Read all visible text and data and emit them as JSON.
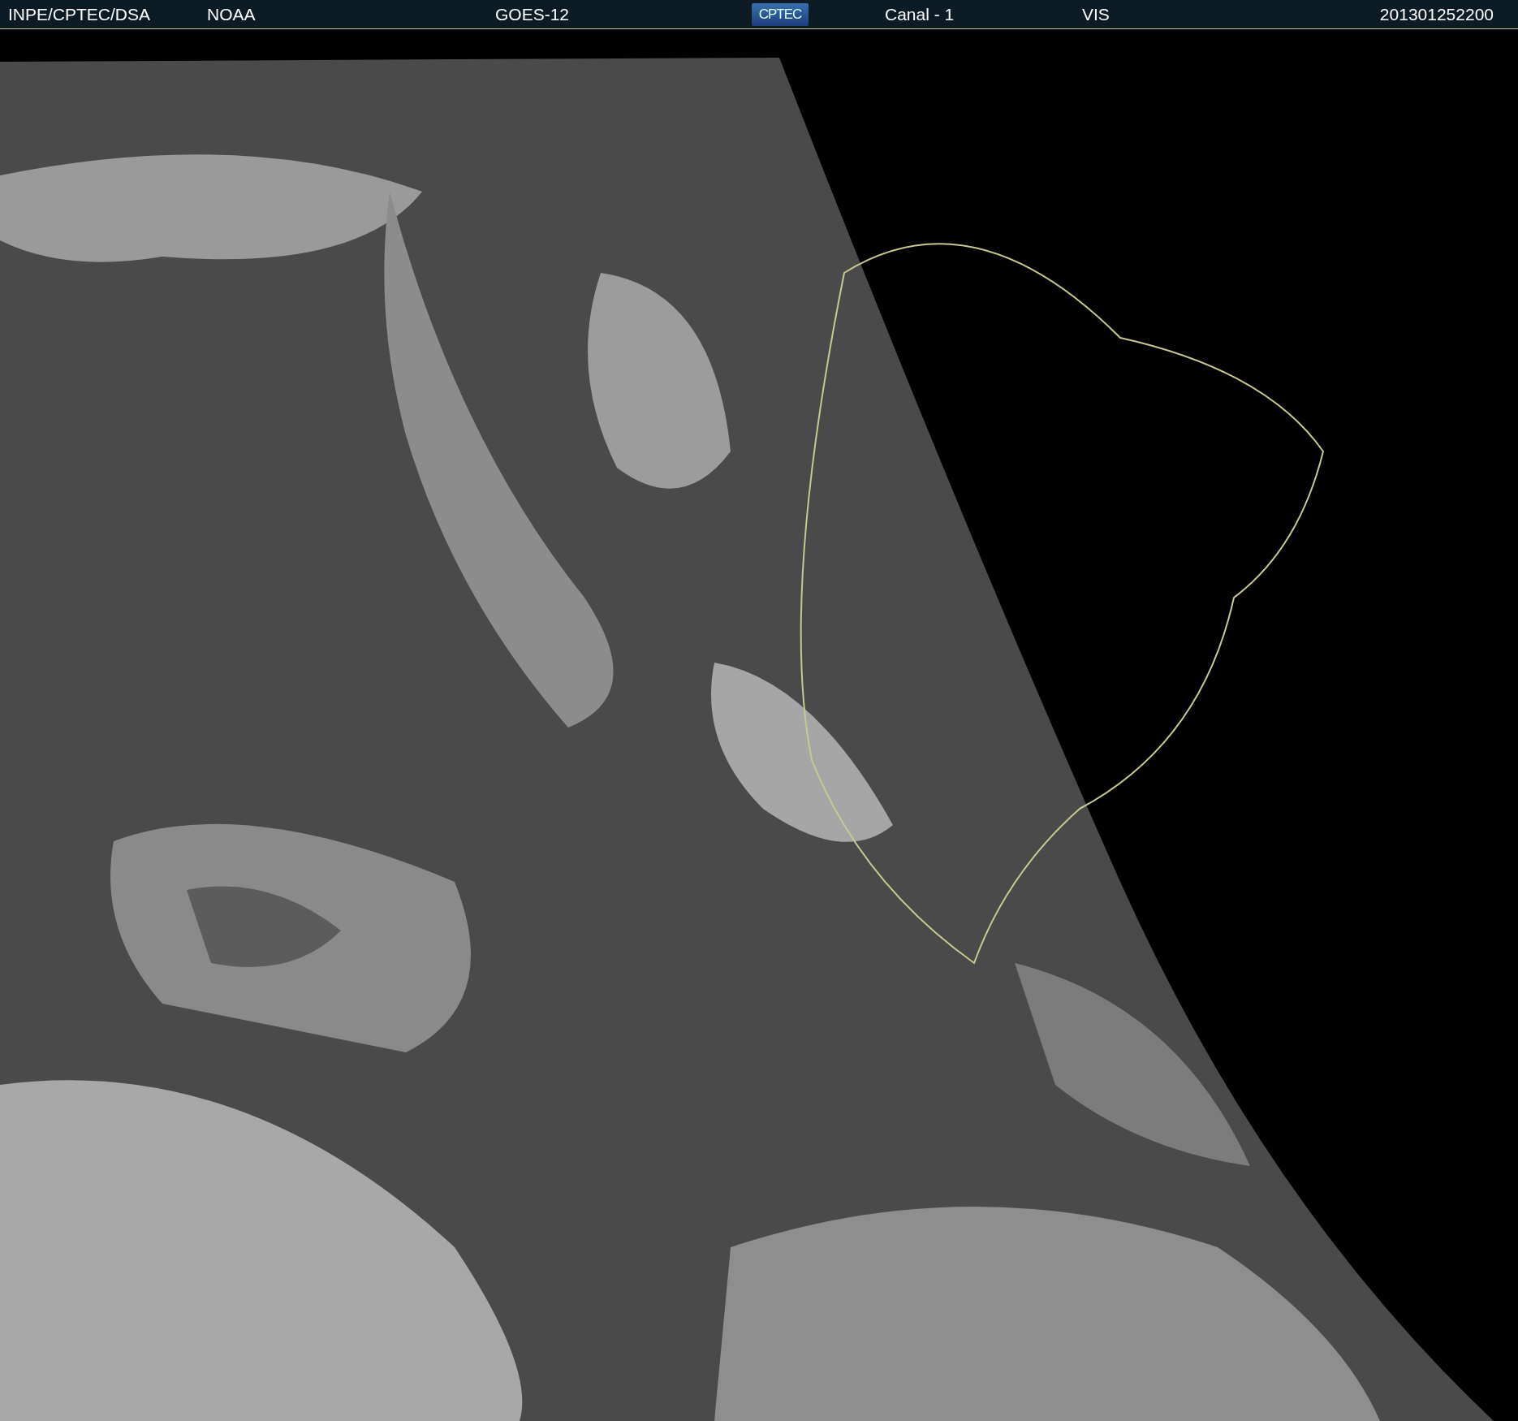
{
  "header": {
    "source": "INPE/CPTEC/DSA",
    "agency": "NOAA",
    "satellite": "GOES-12",
    "logo": "CPTEC",
    "channel": "Canal - 1",
    "band": "VIS",
    "timestamp": "201301252200"
  }
}
